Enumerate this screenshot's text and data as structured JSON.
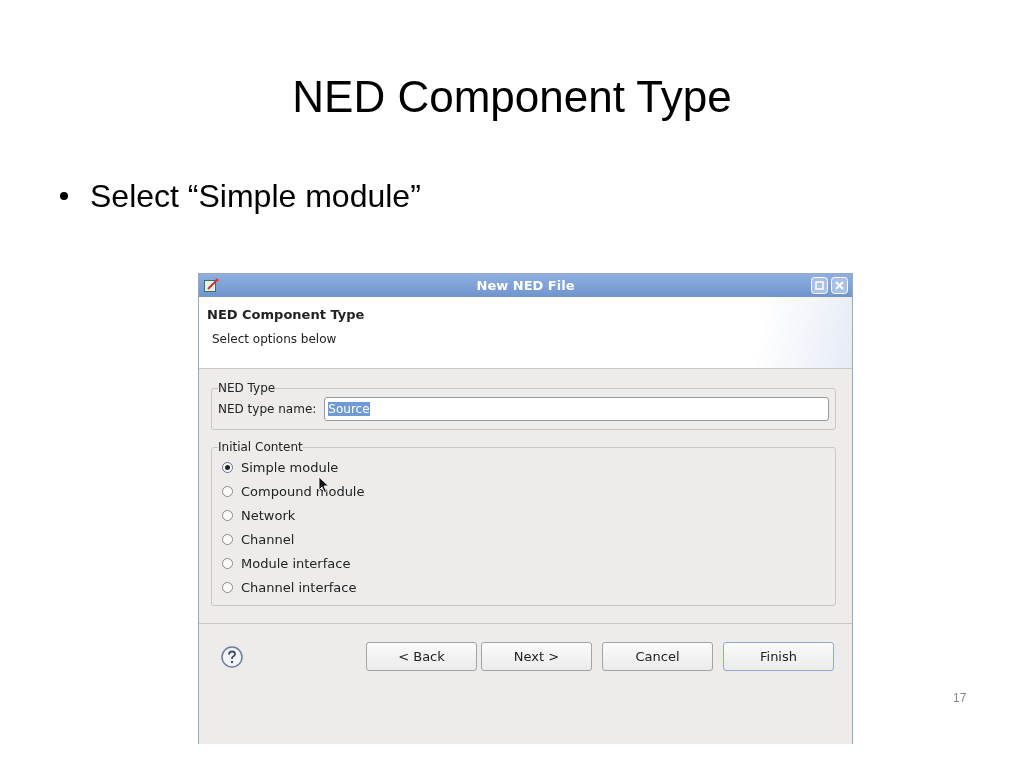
{
  "slide": {
    "title": "NED Component Type",
    "bullets": [
      "Select “Simple module”"
    ],
    "page_number": "17"
  },
  "dialog": {
    "title": "New NED File",
    "header": {
      "title": "NED Component Type",
      "subtitle": "Select options below"
    },
    "name_group": {
      "legend": "NED Type",
      "label": "NED type name:",
      "value": "Source"
    },
    "content_group": {
      "legend": "Initial Content",
      "options": [
        {
          "label": "Simple module",
          "selected": true
        },
        {
          "label": "Compound module",
          "selected": false
        },
        {
          "label": "Network",
          "selected": false
        },
        {
          "label": "Channel",
          "selected": false
        },
        {
          "label": "Module interface",
          "selected": false
        },
        {
          "label": "Channel interface",
          "selected": false
        }
      ]
    },
    "buttons": [
      {
        "label": "< Back",
        "default": false
      },
      {
        "label": "Next >",
        "default": false
      },
      {
        "label": "Cancel",
        "default": false
      },
      {
        "label": "Finish",
        "default": true
      }
    ]
  }
}
